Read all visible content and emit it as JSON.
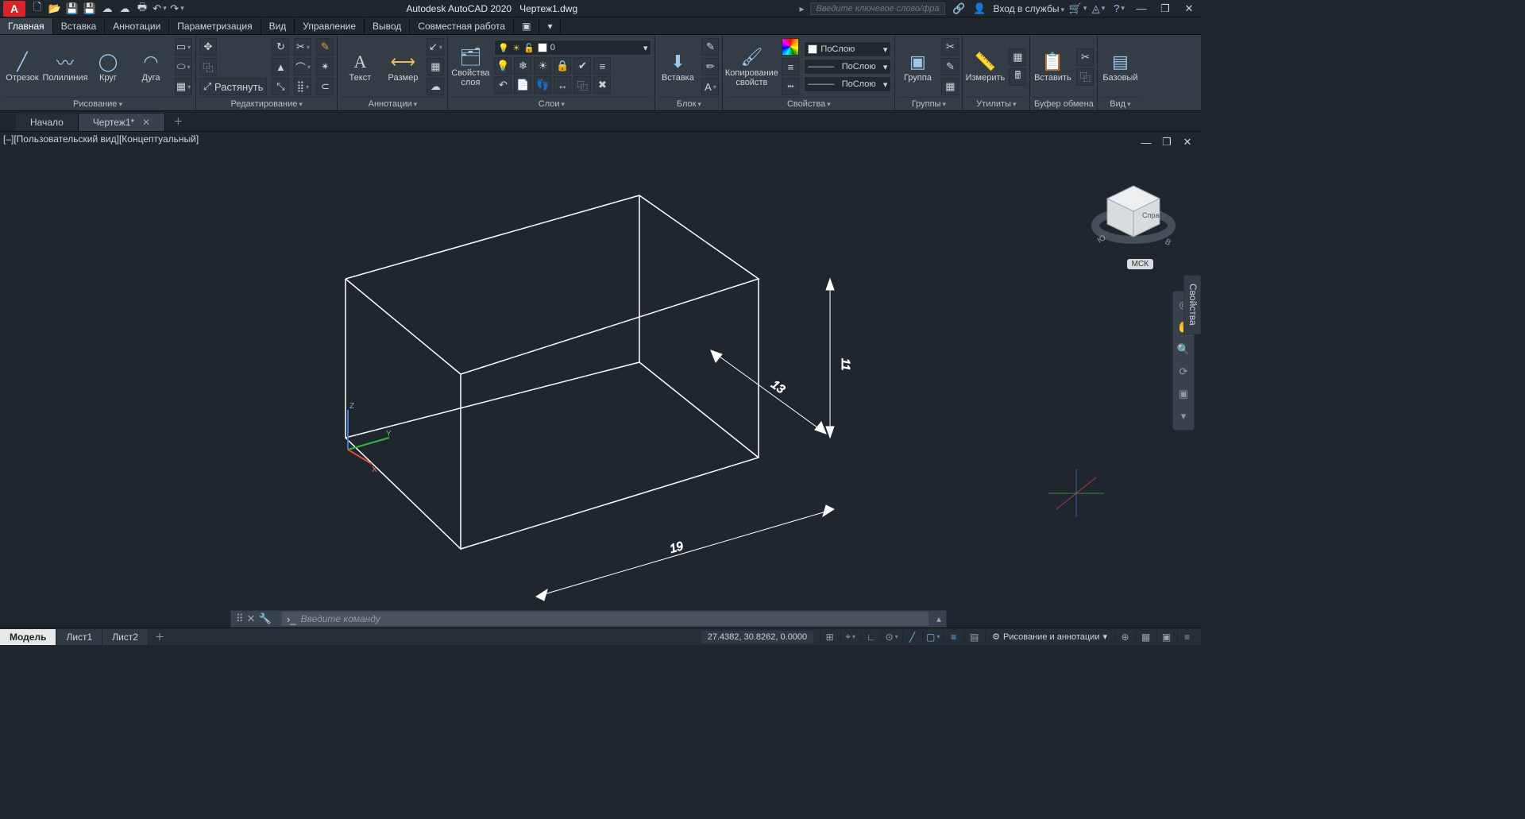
{
  "app": {
    "title": "Autodesk AutoCAD 2020",
    "file": "Чертеж1.dwg",
    "logo": "A"
  },
  "search": {
    "placeholder": "Введите ключевое слово/фразу"
  },
  "signin": "Вход в службы",
  "tabs": {
    "items": [
      "Главная",
      "Вставка",
      "Аннотации",
      "Параметризация",
      "Вид",
      "Управление",
      "Вывод",
      "Совместная работа"
    ],
    "active": 0
  },
  "ribbon": {
    "draw": {
      "title": "Рисование",
      "line": "Отрезок",
      "polyline": "Полилиния",
      "circle": "Круг",
      "arc": "Дуга"
    },
    "modify": {
      "title": "Редактирование",
      "stretch": "Растянуть"
    },
    "annot": {
      "title": "Аннотации",
      "text": "Текст",
      "dim": "Размер"
    },
    "layers": {
      "title": "Слои",
      "props": "Свойства слоя",
      "current": "0"
    },
    "block": {
      "title": "Блок",
      "insert": "Вставка"
    },
    "props": {
      "title": "Свойства",
      "match": "Копирование свойств",
      "bylayer": "ПоСлою"
    },
    "groups": {
      "title": "Группы",
      "group": "Группа"
    },
    "utils": {
      "title": "Утилиты",
      "measure": "Измерить"
    },
    "clipboard": {
      "title": "Буфер обмена",
      "paste": "Вставить"
    },
    "view": {
      "title": "Вид",
      "base": "Базовый"
    }
  },
  "file_tabs": {
    "items": [
      {
        "label": "Начало",
        "closable": false
      },
      {
        "label": "Чертеж1*",
        "closable": true
      }
    ],
    "active": 1
  },
  "viewport": {
    "label": "[–][Пользовательский вид][Концептуальный]",
    "wcs": "МСК",
    "cube_face": "Справа",
    "properties_tab": "Свойства"
  },
  "dimensions": {
    "width": "19",
    "depth": "13",
    "height": "11"
  },
  "cmd": {
    "placeholder": "Введите команду"
  },
  "layout_tabs": {
    "items": [
      "Модель",
      "Лист1",
      "Лист2"
    ],
    "active": 0
  },
  "status": {
    "coords": "27.4382, 30.8262, 0.0000",
    "workspace": "Рисование и аннотации"
  }
}
